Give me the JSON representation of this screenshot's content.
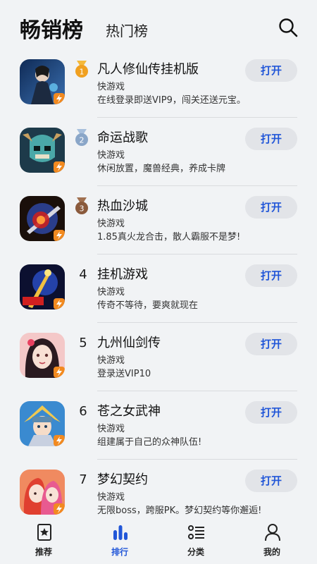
{
  "header": {
    "title": "畅销榜",
    "subtitle": "热门榜",
    "search_icon": "search-icon"
  },
  "colors": {
    "accent": "#2156d8",
    "button_bg": "#e2e4e8",
    "gold": "#f0a020",
    "silver": "#8aa6c8",
    "bronze": "#8a5a3c"
  },
  "apps": [
    {
      "rank": "1",
      "name": "凡人修仙传挂机版",
      "category": "快游戏",
      "desc": "在线登录即送VIP9，闯关还送元宝。",
      "button": "打开",
      "medal": "gold"
    },
    {
      "rank": "2",
      "name": "命运战歌",
      "category": "快游戏",
      "desc": "休闲放置，魔兽经典，养成卡牌",
      "button": "打开",
      "medal": "silver"
    },
    {
      "rank": "3",
      "name": "热血沙城",
      "category": "快游戏",
      "desc": "1.85真火龙合击，散人霸服不是梦!",
      "button": "打开",
      "medal": "bronze"
    },
    {
      "rank": "4",
      "name": "挂机游戏",
      "category": "快游戏",
      "desc": "传奇不等待，要爽就现在",
      "button": "打开",
      "medal": ""
    },
    {
      "rank": "5",
      "name": "九州仙剑传",
      "category": "快游戏",
      "desc": "登录送VIP10",
      "button": "打开",
      "medal": ""
    },
    {
      "rank": "6",
      "name": "苍之女武神",
      "category": "快游戏",
      "desc": "组建属于自己的众神队伍!",
      "button": "打开",
      "medal": ""
    },
    {
      "rank": "7",
      "name": "梦幻契约",
      "category": "快游戏",
      "desc": "无限boss，跨服PK。梦幻契约等你邂逅!",
      "button": "打开",
      "medal": ""
    }
  ],
  "tabs": [
    {
      "label": "推荐",
      "icon": "star-icon",
      "active": false
    },
    {
      "label": "排行",
      "icon": "bar-chart-icon",
      "active": true
    },
    {
      "label": "分类",
      "icon": "list-icon",
      "active": false
    },
    {
      "label": "我的",
      "icon": "person-icon",
      "active": false
    }
  ]
}
